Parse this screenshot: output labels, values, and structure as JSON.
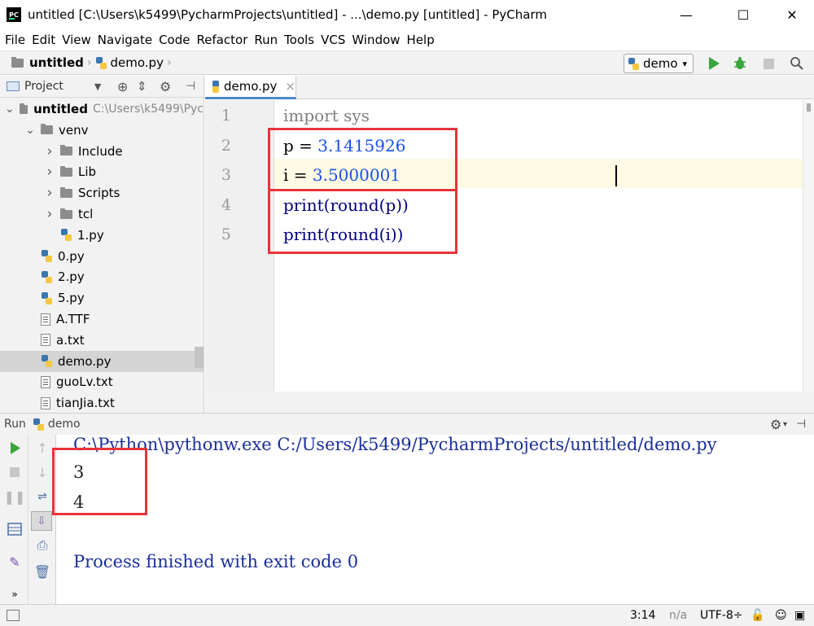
{
  "window": {
    "title": "untitled [C:\\Users\\k5499\\PycharmProjects\\untitled] - ...\\demo.py [untitled] - PyCharm",
    "logo_text": "PC",
    "minimize": "—",
    "maximize": "☐",
    "close": "✕"
  },
  "menu": [
    "File",
    "Edit",
    "View",
    "Navigate",
    "Code",
    "Refactor",
    "Run",
    "Tools",
    "VCS",
    "Window",
    "Help"
  ],
  "navbar": {
    "breadcrumbs": [
      "untitled",
      "demo.py"
    ],
    "run_config": "demo"
  },
  "project": {
    "header_label": "Project",
    "tree": [
      {
        "label": "untitled",
        "path": "C:\\Users\\k5499\\Pyc",
        "icon": "folder-icon",
        "indent": 0,
        "expanded": true,
        "bold": true
      },
      {
        "label": "venv",
        "icon": "folder-icon",
        "indent": 1,
        "expanded": true
      },
      {
        "label": "Include",
        "icon": "folder-icon",
        "indent": 2,
        "expanded": false
      },
      {
        "label": "Lib",
        "icon": "folder-icon",
        "indent": 2,
        "expanded": false
      },
      {
        "label": "Scripts",
        "icon": "folder-icon",
        "indent": 2,
        "expanded": false
      },
      {
        "label": "tcl",
        "icon": "folder-icon",
        "indent": 2,
        "expanded": false
      },
      {
        "label": "1.py",
        "icon": "python-file-icon",
        "indent": 2
      },
      {
        "label": "0.py",
        "icon": "python-file-icon",
        "indent": 1
      },
      {
        "label": "2.py",
        "icon": "python-file-icon",
        "indent": 1
      },
      {
        "label": "5.py",
        "icon": "python-file-icon",
        "indent": 1
      },
      {
        "label": "A.TTF",
        "icon": "text-file-icon",
        "indent": 1
      },
      {
        "label": "a.txt",
        "icon": "text-file-icon",
        "indent": 1
      },
      {
        "label": "demo.py",
        "icon": "python-file-icon",
        "indent": 1,
        "selected": true
      },
      {
        "label": "guoLv.txt",
        "icon": "text-file-icon",
        "indent": 1
      },
      {
        "label": "tianJia.txt",
        "icon": "text-file-icon",
        "indent": 1
      }
    ]
  },
  "editor": {
    "tab_label": "demo.py",
    "tab_close": "×",
    "line_numbers": [
      "1",
      "2",
      "3",
      "4",
      "5"
    ],
    "lines": [
      {
        "tokens": [
          {
            "text": "import sys",
            "kind": "keyword-dim"
          }
        ]
      },
      {
        "tokens": [
          {
            "text": "p = ",
            "kind": "plain"
          },
          {
            "text": "3.1415926",
            "kind": "number"
          }
        ]
      },
      {
        "tokens": [
          {
            "text": "i = ",
            "kind": "plain"
          },
          {
            "text": "3.5000001",
            "kind": "number"
          }
        ]
      },
      {
        "tokens": [
          {
            "text": "print(round(p))",
            "kind": "function"
          }
        ]
      },
      {
        "tokens": [
          {
            "text": "print(round(i))",
            "kind": "function"
          }
        ]
      }
    ]
  },
  "run": {
    "header_label": "Run",
    "config_name": "demo",
    "console": {
      "command": "C:\\Python\\pythonw.exe C:/Users/k5499/PycharmProjects/untitled/demo.py",
      "output": [
        "3",
        "4"
      ],
      "finished": "Process finished with exit code 0"
    }
  },
  "status": {
    "position": "3:14",
    "line_sep": "n/a",
    "encoding": "UTF-8÷"
  },
  "colors": {
    "accent_blue": "#4a88c7",
    "annotation_red": "#e8333a",
    "number_blue": "#1750eb",
    "function_navy": "#000080",
    "run_green": "#3ca43c"
  }
}
